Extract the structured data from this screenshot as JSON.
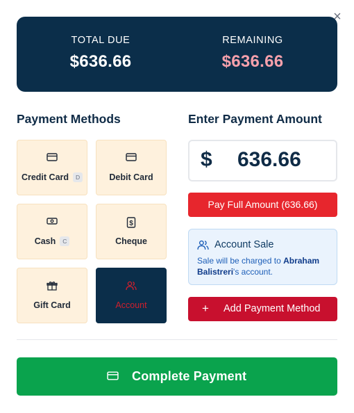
{
  "dialog": {
    "close_label": "×"
  },
  "summary": {
    "total_due_label": "TOTAL DUE",
    "total_due_value": "$636.66",
    "remaining_label": "REMAINING",
    "remaining_value": "$636.66"
  },
  "payment_methods": {
    "title": "Payment Methods",
    "items": [
      {
        "label": "Credit Card",
        "key": "D",
        "icon": "credit-card-icon"
      },
      {
        "label": "Debit Card",
        "key": "",
        "icon": "credit-card-icon"
      },
      {
        "label": "Cash",
        "key": "C",
        "icon": "cash-icon"
      },
      {
        "label": "Cheque",
        "key": "",
        "icon": "cheque-icon"
      },
      {
        "label": "Gift Card",
        "key": "",
        "icon": "gift-icon"
      },
      {
        "label": "Account",
        "key": "",
        "icon": "users-icon",
        "selected": true
      }
    ]
  },
  "amount": {
    "title": "Enter Payment Amount",
    "currency_symbol": "$",
    "value": "636.66",
    "pay_full_label": "Pay Full Amount (636.66)"
  },
  "account_sale": {
    "title": "Account Sale",
    "desc_prefix": "Sale will be charged to ",
    "customer_name": "Abraham Balistreri",
    "desc_suffix": "'s account."
  },
  "add_method_label": "Add Payment Method",
  "add_method_icon": "+",
  "complete_label": "Complete Payment",
  "colors": {
    "navy": "#0b2e4a",
    "remaining_pink": "#f7a1ac",
    "red": "#e7262d",
    "dark_red": "#c8102e",
    "green": "#0aa34d",
    "method_bg": "#fef1dd",
    "account_bg": "#eaf3fd"
  }
}
